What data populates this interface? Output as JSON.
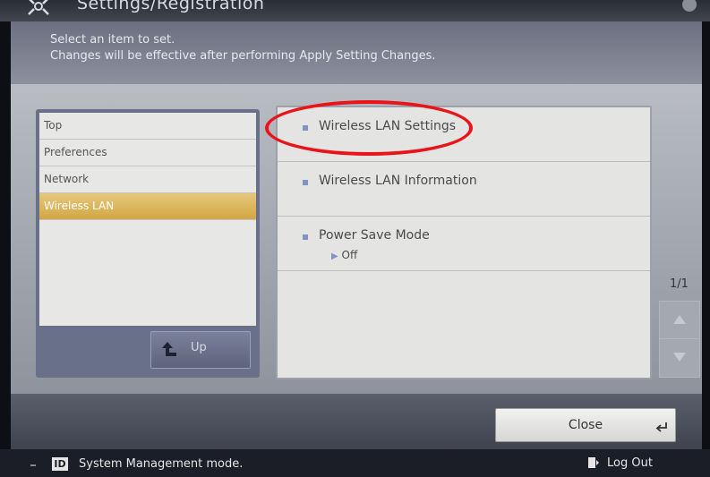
{
  "header": {
    "title": "Settings/Registration"
  },
  "instructions": {
    "line1": "Select an item to set.",
    "line2": "Changes will be effective after performing Apply Setting Changes."
  },
  "nav": {
    "items": [
      {
        "label": "Top",
        "selected": false
      },
      {
        "label": "Preferences",
        "selected": false
      },
      {
        "label": "Network",
        "selected": false
      },
      {
        "label": "Wireless LAN",
        "selected": true
      }
    ],
    "up_label": "Up"
  },
  "settings": {
    "items": [
      {
        "label": "Wireless LAN Settings",
        "value": ""
      },
      {
        "label": "Wireless LAN Information",
        "value": ""
      },
      {
        "label": "Power Save Mode",
        "value": "Off"
      }
    ]
  },
  "pager": {
    "page": "1/1"
  },
  "footer": {
    "close_label": "Close"
  },
  "status": {
    "id_badge": "ID",
    "mode_text": "System Management mode.",
    "logout_label": "Log Out"
  },
  "colors": {
    "highlight_ring": "#e8141a",
    "selected_item": "#d3a743",
    "accent_bullet": "#7f94c2"
  }
}
